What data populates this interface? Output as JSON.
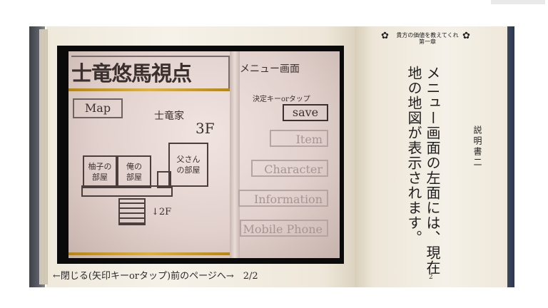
{
  "screenshot": {
    "title": "士竜悠馬視点",
    "map_button": "Map",
    "floor_label": "士竜家",
    "floor_number": "3F",
    "rooms": [
      "柚子の部屋",
      "俺の部屋",
      "父さんの部屋"
    ],
    "down_label": "↓2F",
    "menu_title": "メニュー画面",
    "hint": "決定キーorタップ",
    "save": "save",
    "menu_items": [
      "Item",
      "Character",
      "Information",
      "Mobile Phone"
    ]
  },
  "caption": "←閉じる(矢印キーorタップ)前のページへ→　2/2",
  "right_page": {
    "header_line1": "貴方の価値を教えてくれ",
    "header_line2": "第一章",
    "side_title": "説明書二",
    "body_col1": "メニュー画面の左面には、現在",
    "body_col2": "地の地図が表示されます。",
    "page_number": "2"
  },
  "colors": {
    "accent_gold": "#e0b23a",
    "bookmark_blue": "#2b3550"
  }
}
